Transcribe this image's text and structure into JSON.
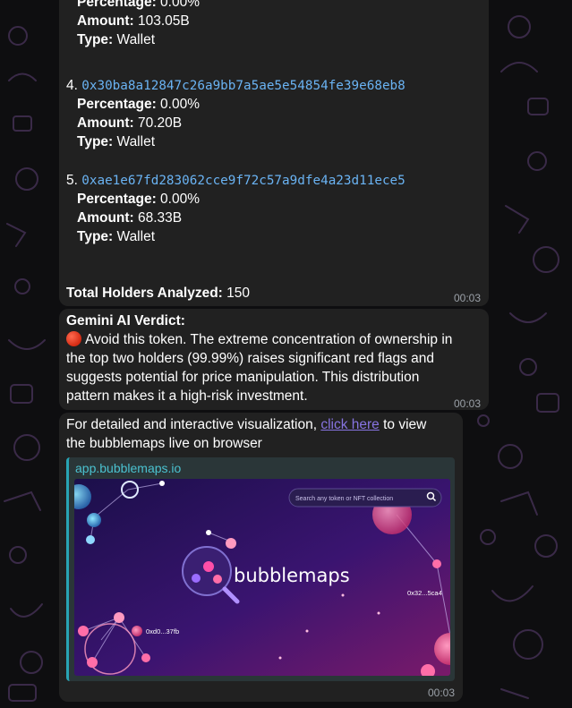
{
  "holders_partial": {
    "percentage_label": "Percentage:",
    "percentage_value": " 0.00%",
    "amount_label": "Amount:",
    "amount_value": " 103.05B",
    "type_label": "Type:",
    "type_value": " Wallet"
  },
  "holders": [
    {
      "index": "4.",
      "address": "0x30ba8a12847c26a9bb7a5ae5e54854fe39e68eb8",
      "percentage_label": "Percentage:",
      "percentage": " 0.00%",
      "amount_label": "Amount:",
      "amount": " 70.20B",
      "type_label": "Type:",
      "type": " Wallet"
    },
    {
      "index": "5.",
      "address": "0xae1e67fd283062cce9f72c57a9dfe4a23d11ece5",
      "percentage_label": "Percentage:",
      "percentage": " 0.00%",
      "amount_label": "Amount:",
      "amount": " 68.33B",
      "type_label": "Type:",
      "type": " Wallet"
    }
  ],
  "total": {
    "label": "Total Holders Analyzed:",
    "value": " 150"
  },
  "verdict": {
    "title": "Gemini AI Verdict:",
    "icon": "red-circle-icon",
    "lines": [
      "Avoid this token. The extreme concentration of ownership in",
      "the top two holders (99.99%) raises significant red flags and",
      "suggests potential for price manipulation. This distribution",
      "pattern makes it a high-risk investment."
    ]
  },
  "link_message": {
    "text_before": "For detailed and interactive visualization, ",
    "link_text": "click here",
    "text_after": " to view",
    "line2": "the bubblemaps live on browser",
    "preview_site": "app.bubblemaps.io",
    "preview_search_placeholder": "Search any token or NFT collection",
    "preview_brand": "bubblemaps",
    "preview_label_right": "0x32...5ca4",
    "preview_label_left": "0xd0...37fb"
  },
  "timestamps": {
    "msg1": "00:03",
    "msg2": "00:03",
    "msg3": "00:03"
  },
  "colors": {
    "bubble": "#212121",
    "link": "#8774e1",
    "address": "#6ab3f3",
    "preview_accent": "#28a4b4"
  }
}
